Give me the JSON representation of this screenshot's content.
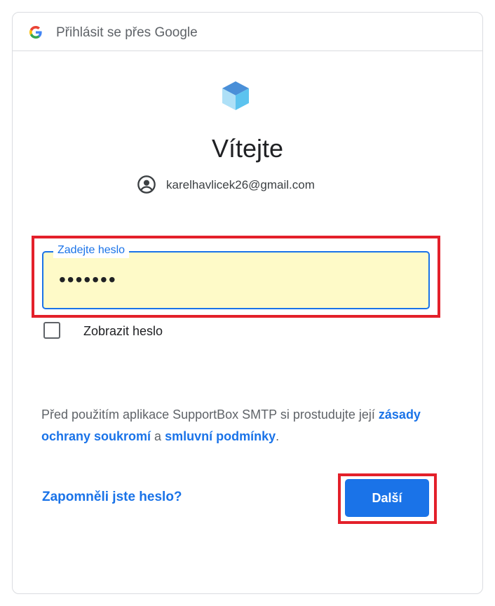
{
  "header": {
    "icon": "google-g-icon",
    "title": "Přihlásit se přes Google"
  },
  "app": {
    "logo": "app-cube-logo"
  },
  "welcome": {
    "title": "Vítejte"
  },
  "account": {
    "icon": "account-circle-icon",
    "email": "karelhavlicek26@gmail.com"
  },
  "password": {
    "label": "Zadejte heslo",
    "value": "•••••••"
  },
  "show_password": {
    "label": "Zobrazit heslo",
    "checked": false
  },
  "privacy": {
    "text_before": "Před použitím aplikace SupportBox SMTP si prostudujte její ",
    "privacy_link": "zásady ochrany soukromí",
    "text_middle": " a ",
    "terms_link": "smluvní podmínky",
    "text_after": "."
  },
  "actions": {
    "forgot_label": "Zapomněli jste heslo?",
    "next_label": "Další"
  },
  "colors": {
    "accent": "#1a73e8",
    "highlight": "#e3202a",
    "autofill_background": "#fefac8"
  }
}
